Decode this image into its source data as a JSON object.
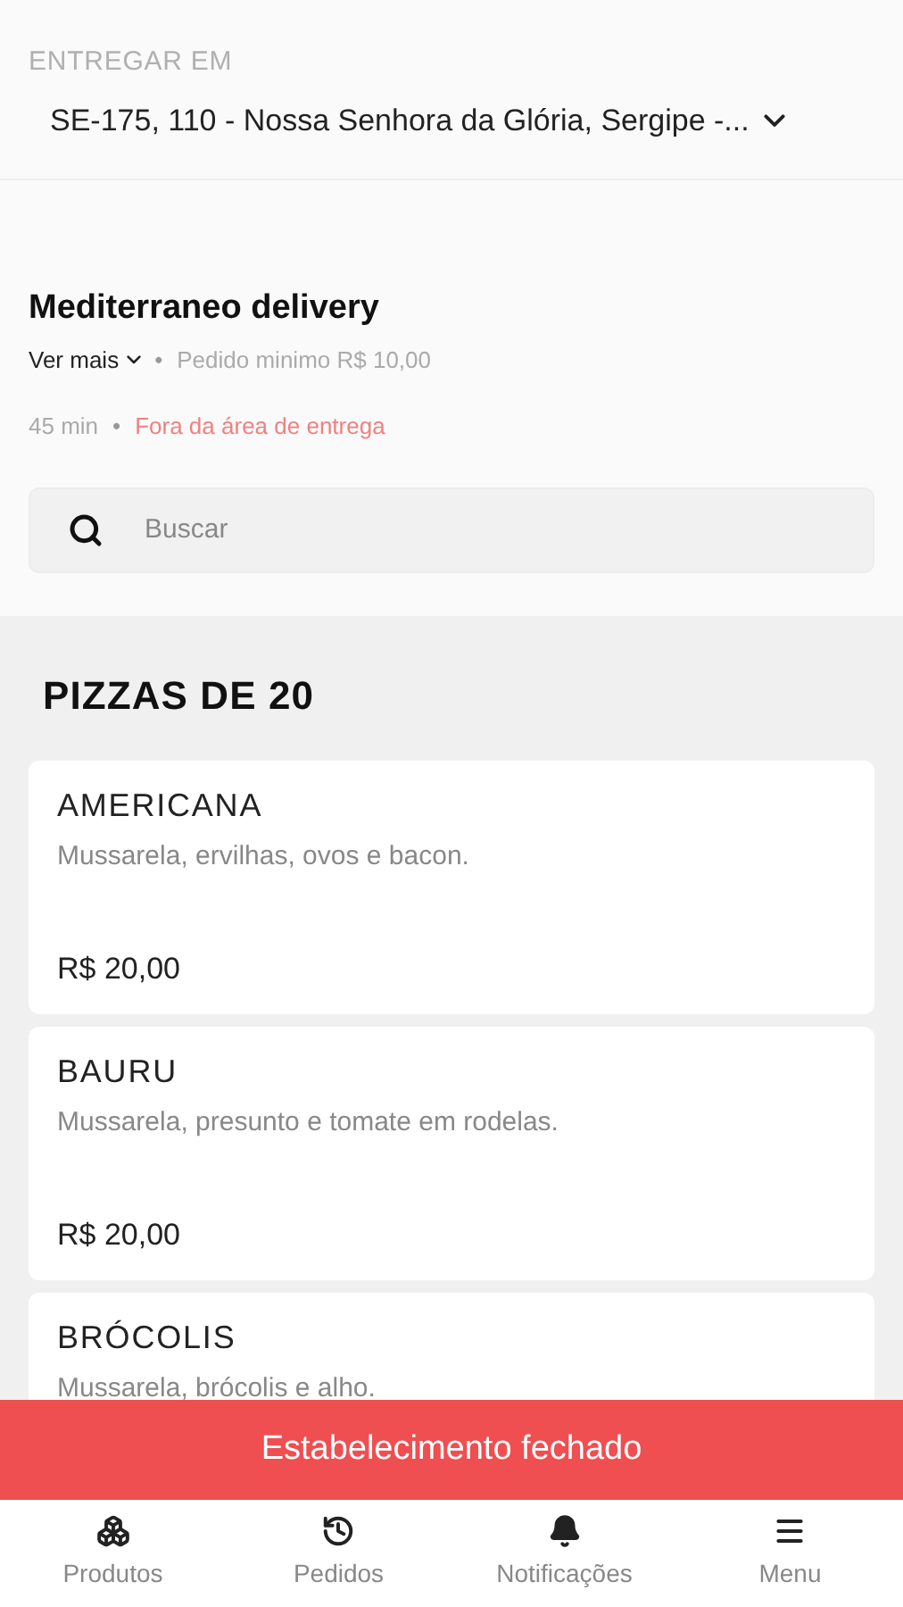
{
  "delivery": {
    "label": "ENTREGAR EM",
    "address": "SE-175, 110 - Nossa Senhora da Glória, Sergipe -..."
  },
  "store": {
    "name": "Mediterraneo delivery",
    "more": "Ver mais",
    "separator": "•",
    "separator_2": "•",
    "minimum": "Pedido minimo R$ 10,00",
    "time": "45 min",
    "status": "Fora da área de entrega"
  },
  "search": {
    "placeholder": "Buscar"
  },
  "category": {
    "title": "PIZZAS DE 20",
    "items": [
      {
        "name": "AMERICANA",
        "description": "Mussarela, ervilhas, ovos e bacon.",
        "price": "R$ 20,00"
      },
      {
        "name": "BAURU",
        "description": "Mussarela, presunto e tomate em rodelas.",
        "price": "R$ 20,00"
      },
      {
        "name": "BRÓCOLIS",
        "description": "Mussarela, brócolis e alho."
      }
    ]
  },
  "banner": "Estabelecimento fechado",
  "nav": [
    {
      "kind": "products",
      "label": "Produtos"
    },
    {
      "kind": "orders",
      "label": "Pedidos"
    },
    {
      "kind": "notifications",
      "label": "Notificações"
    },
    {
      "kind": "menu",
      "label": "Menu"
    }
  ]
}
